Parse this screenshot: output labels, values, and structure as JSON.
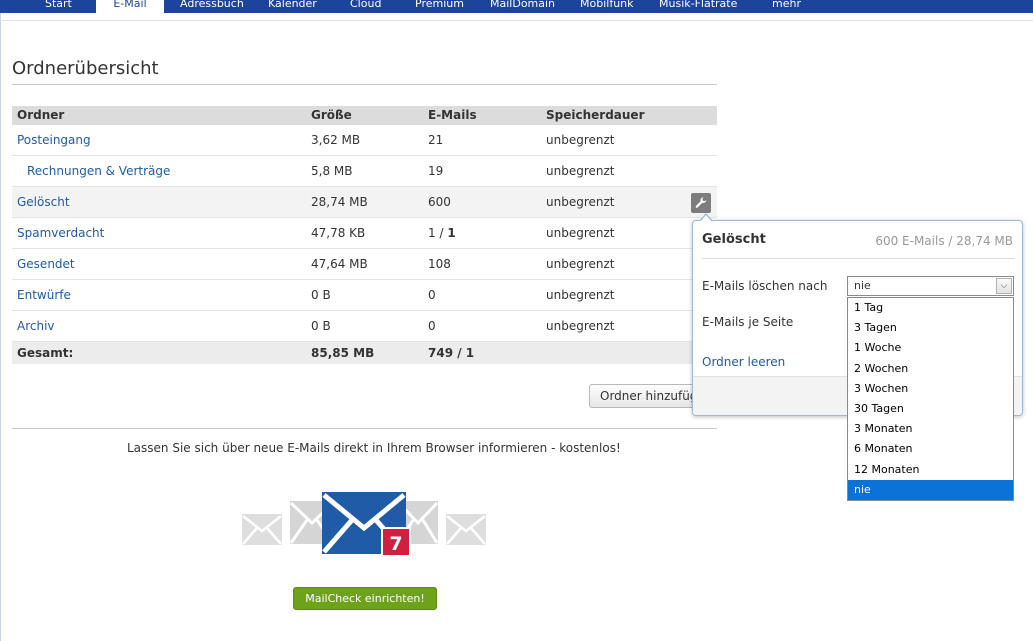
{
  "nav": {
    "tabs": [
      "Start",
      "E-Mail",
      "Adressbuch",
      "Kalender",
      "Cloud",
      "Premium",
      "MailDomain",
      "Mobilfunk",
      "Musik-Flatrate",
      "mehr"
    ],
    "active": "E-Mail"
  },
  "page": {
    "title": "Ordnerübersicht"
  },
  "table": {
    "headers": [
      "Ordner",
      "Größe",
      "E-Mails",
      "Speicherdauer"
    ],
    "rows": [
      {
        "name": "Posteingang",
        "size": "3,62 MB",
        "mails": "21",
        "retention": "unbegrenzt"
      },
      {
        "name": "Rechnungen & Verträge",
        "size": "5,8 MB",
        "mails": "19",
        "retention": "unbegrenzt"
      },
      {
        "name": "Gelöscht",
        "size": "28,74 MB",
        "mails": "600",
        "retention": "unbegrenzt"
      },
      {
        "name": "Spamverdacht",
        "size": "47,78 KB",
        "mails_total": "1 / ",
        "mails_unread": "1",
        "retention": "unbegrenzt"
      },
      {
        "name": "Gesendet",
        "size": "47,64 MB",
        "mails": "108",
        "retention": "unbegrenzt"
      },
      {
        "name": "Entwürfe",
        "size": "0 B",
        "mails": "0",
        "retention": "unbegrenzt"
      },
      {
        "name": "Archiv",
        "size": "0 B",
        "mails": "0",
        "retention": "unbegrenzt"
      }
    ],
    "total": {
      "label": "Gesamt:",
      "size": "85,85 MB",
      "mails": "749 / 1"
    }
  },
  "add_folder_button": "Ordner hinzufügen",
  "promo": {
    "text": "Lassen Sie sich über neue E-Mails direkt in Ihrem Browser informieren - kostenlos!",
    "badge_count": "7",
    "button": "MailCheck einrichten!",
    "colors": {
      "envelope": "#1f5ba6",
      "badge": "#d0203f",
      "button": "#6ea218"
    }
  },
  "popover": {
    "title": "Gelöscht",
    "meta": "600 E-Mails / 28,74 MB",
    "delete_after_label": "E-Mails löschen nach",
    "per_page_label": "E-Mails je Seite",
    "empty_link": "Ordner leeren",
    "selected_option": "nie",
    "options": [
      "1 Tag",
      "3 Tagen",
      "1 Woche",
      "2 Wochen",
      "3 Wochen",
      "30 Tagen",
      "3 Monaten",
      "6 Monaten",
      "12 Monaten",
      "nie"
    ]
  }
}
